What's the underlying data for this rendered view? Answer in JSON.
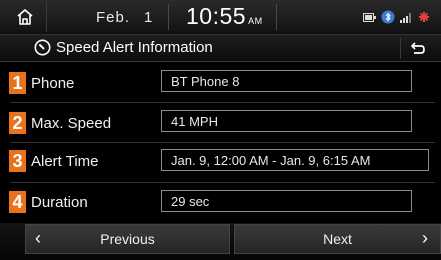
{
  "status": {
    "month": "Feb.",
    "day": "1",
    "time": "10:55",
    "ampm": "AM"
  },
  "header": {
    "title": "Speed Alert Information"
  },
  "rows": [
    {
      "number": "1",
      "label": "Phone",
      "value": "BT Phone 8"
    },
    {
      "number": "2",
      "label": "Max. Speed",
      "value": "41 MPH"
    },
    {
      "number": "3",
      "label": "Alert Time",
      "value": "Jan. 9, 12:00 AM - Jan. 9, 6:15 AM"
    },
    {
      "number": "4",
      "label": "Duration",
      "value": "29 sec"
    }
  ],
  "footer": {
    "previous_label": "Previous",
    "next_label": "Next"
  },
  "colors": {
    "accent": "#e8731c"
  }
}
